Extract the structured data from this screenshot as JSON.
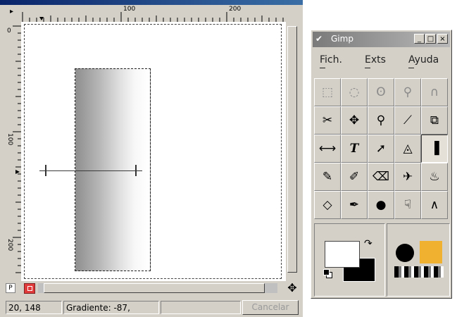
{
  "canvas_window": {
    "rulers": {
      "horizontal_labels": [
        "100",
        "200"
      ],
      "vertical_labels": [
        "0",
        "100",
        "200"
      ]
    },
    "quickmask_label": "P",
    "status": {
      "coords": "20, 148",
      "message": "Gradiente: -87,",
      "cancel_label": "Cancelar"
    }
  },
  "toolbox": {
    "title": "Gimp",
    "title_buttons": [
      "_",
      "□",
      "×"
    ],
    "menu": [
      "Fich.",
      "Exts",
      "Ayuda"
    ],
    "tools": [
      {
        "name": "rect-select",
        "glyph": "⬚"
      },
      {
        "name": "ellipse-select",
        "glyph": "◌"
      },
      {
        "name": "lasso",
        "glyph": "ʘ"
      },
      {
        "name": "magic-wand",
        "glyph": "⚲"
      },
      {
        "name": "bezier",
        "glyph": "∩"
      },
      {
        "name": "scissors",
        "glyph": "✂"
      },
      {
        "name": "move",
        "glyph": "✥"
      },
      {
        "name": "zoom",
        "glyph": "⚲"
      },
      {
        "name": "crop",
        "glyph": "⟋"
      },
      {
        "name": "transform",
        "glyph": "⧉"
      },
      {
        "name": "flip",
        "glyph": "⟷"
      },
      {
        "name": "text",
        "glyph": "T"
      },
      {
        "name": "color-picker",
        "glyph": "➚"
      },
      {
        "name": "bucket-fill",
        "glyph": "◬"
      },
      {
        "name": "blend",
        "glyph": "▐"
      },
      {
        "name": "pencil",
        "glyph": "✎"
      },
      {
        "name": "paintbrush",
        "glyph": "✐"
      },
      {
        "name": "eraser",
        "glyph": "⌫"
      },
      {
        "name": "airbrush",
        "glyph": "✈"
      },
      {
        "name": "clone",
        "glyph": "♨"
      },
      {
        "name": "blur",
        "glyph": "◇"
      },
      {
        "name": "ink",
        "glyph": "✒"
      },
      {
        "name": "dodge-burn",
        "glyph": "●"
      },
      {
        "name": "smudge",
        "glyph": "☟"
      },
      {
        "name": "measure",
        "glyph": "∧"
      }
    ],
    "active_tool_index": 14,
    "colors": {
      "foreground": "#ffffff",
      "background": "#000000",
      "pattern": "#f0b030"
    }
  }
}
